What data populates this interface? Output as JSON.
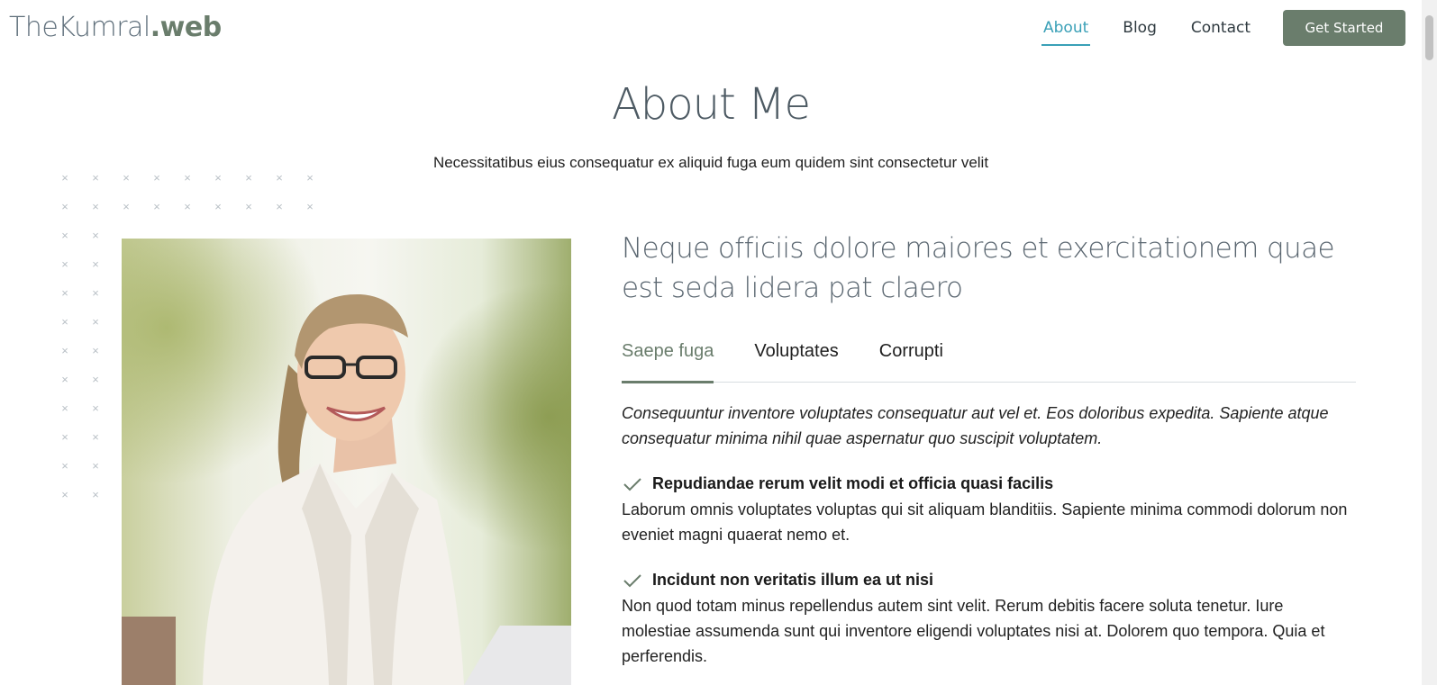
{
  "header": {
    "logo_main": "TheKumral",
    "logo_accent": ".web",
    "nav": [
      {
        "label": "About",
        "active": true
      },
      {
        "label": "Blog",
        "active": false
      },
      {
        "label": "Contact",
        "active": false
      }
    ],
    "cta_label": "Get Started"
  },
  "about": {
    "title": "About Me",
    "subtitle": "Necessitatibus eius consequatur ex aliquid fuga eum quidem sint consectetur velit"
  },
  "content": {
    "heading": "Neque officiis dolore maiores et exercitationem quae est seda lidera pat claero",
    "tabs": [
      {
        "label": "Saepe fuga",
        "active": true
      },
      {
        "label": "Voluptates",
        "active": false
      },
      {
        "label": "Corrupti",
        "active": false
      }
    ],
    "intro": "Consequuntur inventore voluptates consequatur aut vel et. Eos doloribus expedita. Sapiente atque consequatur minima nihil quae aspernatur quo suscipit voluptatem.",
    "features": [
      {
        "title": "Repudiandae rerum velit modi et officia quasi facilis",
        "text": "Laborum omnis voluptates voluptas qui sit aliquam blanditiis. Sapiente minima commodi dolorum non eveniet magni quaerat nemo et."
      },
      {
        "title": "Incidunt non veritatis illum ea ut nisi",
        "text": "Non quod totam minus repellendus autem sint velit. Rerum debitis facere soluta tenetur. Iure molestiae assumenda sunt qui inventore eligendi voluptates nisi at. Dolorem quo tempora. Quia et perferendis."
      }
    ]
  },
  "colors": {
    "accent_green": "#6a7d6c",
    "nav_active": "#3aa0b7",
    "title_gray": "#4d5a63"
  },
  "icons": {
    "feature_check": "check-icon",
    "pattern": "x-mark-icon"
  }
}
